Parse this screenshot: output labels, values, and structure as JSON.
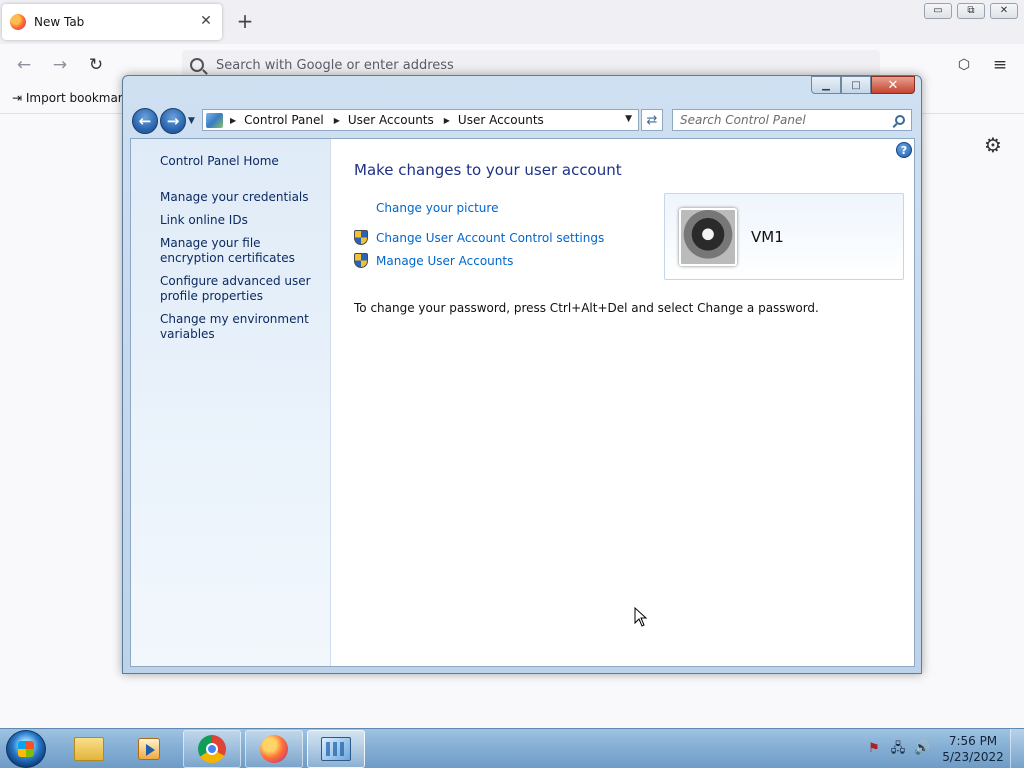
{
  "browser": {
    "tab_title": "New Tab",
    "tab_close": "✕",
    "new_tab": "+",
    "url_placeholder": "Search with Google or enter address",
    "bookmark_import": "Import bookmark",
    "icons": {
      "back": "←",
      "forward": "→",
      "reload": "↻",
      "pocket": "pocket-icon",
      "menu": "≡",
      "settings": "⚙"
    },
    "window_buttons": {
      "minimize": "▭",
      "restore": "⧉",
      "close": "✕"
    }
  },
  "control_panel": {
    "breadcrumb": [
      "Control Panel",
      "User Accounts",
      "User Accounts"
    ],
    "search_placeholder": "Search Control Panel",
    "caption_buttons": {
      "minimize": "▁",
      "maximize": "□",
      "close": "✕"
    },
    "sidebar": {
      "home": "Control Panel Home",
      "links": [
        "Manage your credentials",
        "Link online IDs",
        "Manage your file encryption certificates",
        "Configure advanced user profile properties",
        "Change my environment variables"
      ]
    },
    "main": {
      "title": "Make changes to your user account",
      "tasks": [
        {
          "label": "Change your picture",
          "shield": false
        },
        {
          "label": "Change User Account Control settings",
          "shield": true
        },
        {
          "label": "Manage User Accounts",
          "shield": true
        }
      ],
      "user_name": "VM1",
      "info_text": "To change your password, press Ctrl+Alt+Del and select Change a password.",
      "help": "?"
    }
  },
  "taskbar": {
    "pinned": [
      "windows-explorer",
      "windows-media-player",
      "google-chrome",
      "firefox",
      "control-panel"
    ],
    "clock_time": "7:56 PM",
    "clock_date": "5/23/2022"
  },
  "colors": {
    "link_blue": "#0066cc",
    "title_blue": "#1e3287",
    "sidebar_link": "#0c2a62",
    "taskbar": "#83add3"
  }
}
